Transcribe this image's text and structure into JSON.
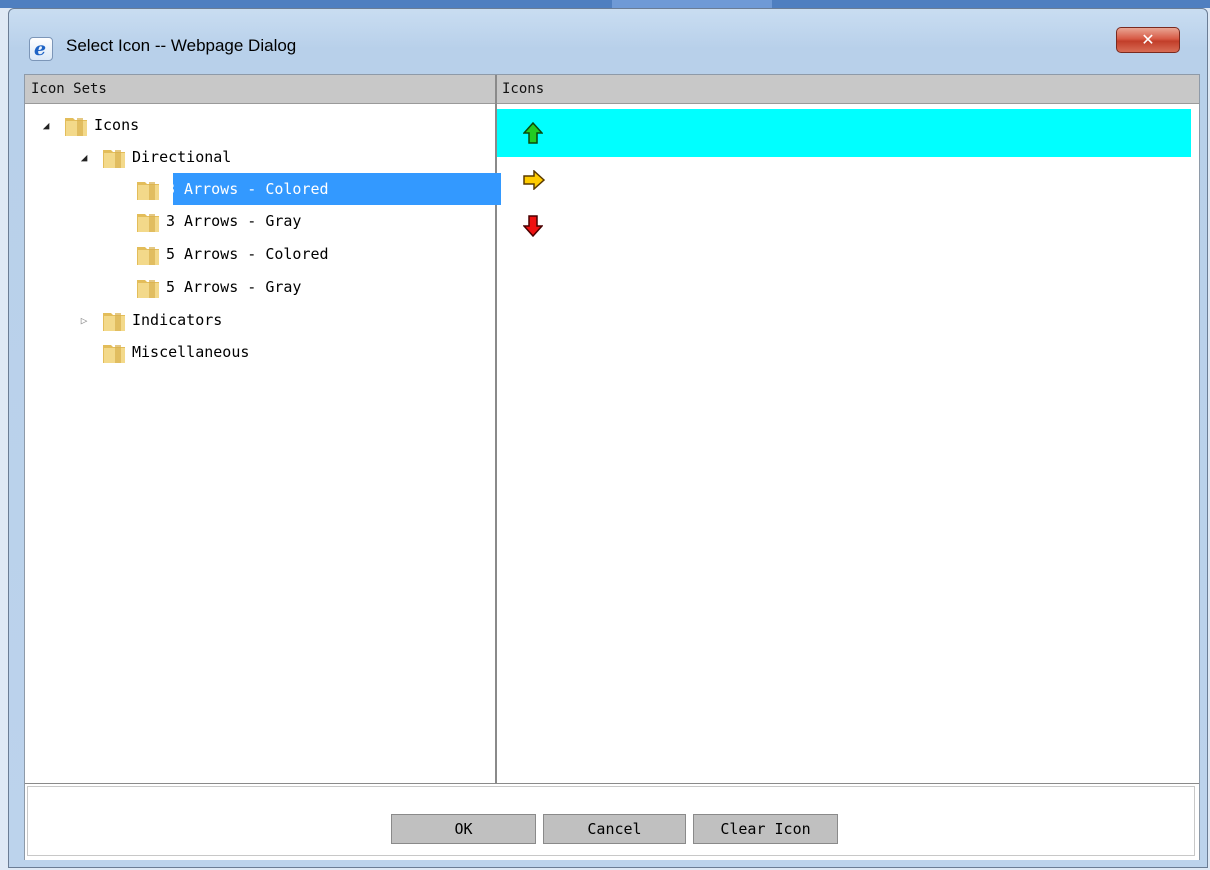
{
  "dialog": {
    "title": "Select Icon -- Webpage Dialog",
    "close_glyph": "✕"
  },
  "columns": {
    "left_header": "Icon Sets",
    "right_header": "Icons"
  },
  "tree": {
    "nodes": [
      {
        "label": "Icons",
        "expanded": true
      },
      {
        "label": "Directional",
        "expanded": true
      },
      {
        "label": "3 Arrows - Colored",
        "selected": true
      },
      {
        "label": "3 Arrows - Gray"
      },
      {
        "label": "5 Arrows - Colored"
      },
      {
        "label": "5 Arrows - Gray"
      },
      {
        "label": "Indicators",
        "expanded": false
      },
      {
        "label": "Miscellaneous"
      }
    ]
  },
  "icons": [
    {
      "name": "arrow-up-green-icon",
      "color": "#22cc22",
      "highlighted": true
    },
    {
      "name": "arrow-right-yellow-icon",
      "color": "#ffcc00"
    },
    {
      "name": "arrow-down-red-icon",
      "color": "#ee1111"
    }
  ],
  "buttons": {
    "ok": "OK",
    "cancel": "Cancel",
    "clear": "Clear Icon"
  },
  "colors": {
    "selection": "#3399ff",
    "icon_highlight": "#00ffff",
    "folder": "#e8c868"
  }
}
